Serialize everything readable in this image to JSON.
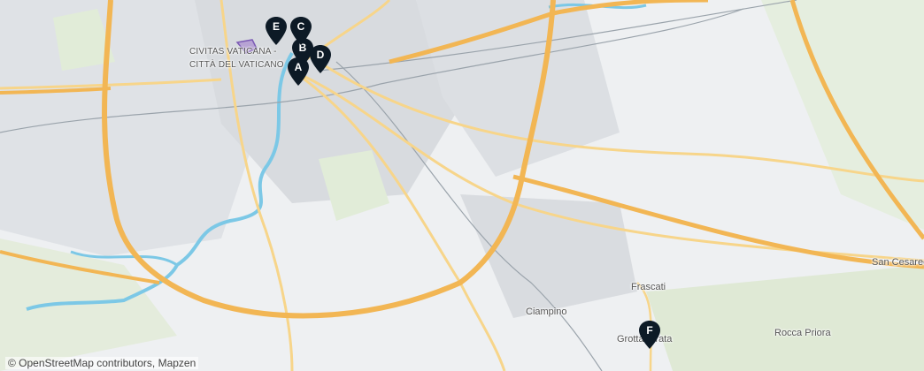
{
  "places": {
    "vatican_1": "CIVITAS VATICANA -",
    "vatican_2": "CITTÀ DEL VATICANO",
    "frascati": "Frascati",
    "ciampino": "Ciampino",
    "grottaferrata": "Grottaferrata",
    "rocca_priora": "Rocca Priora",
    "san_cesareo": "San Cesareo"
  },
  "markers": [
    {
      "label": "A"
    },
    {
      "label": "B"
    },
    {
      "label": "C"
    },
    {
      "label": "D"
    },
    {
      "label": "E"
    },
    {
      "label": "F"
    }
  ],
  "attribution": "© OpenStreetMap contributors, Mapzen",
  "colors": {
    "motorway": "#f2b654",
    "primary": "#f7d58a",
    "river": "#7cc8e6",
    "urban": "#d7dadd",
    "park": "#e2eed8",
    "marker": "#0d1a26"
  }
}
